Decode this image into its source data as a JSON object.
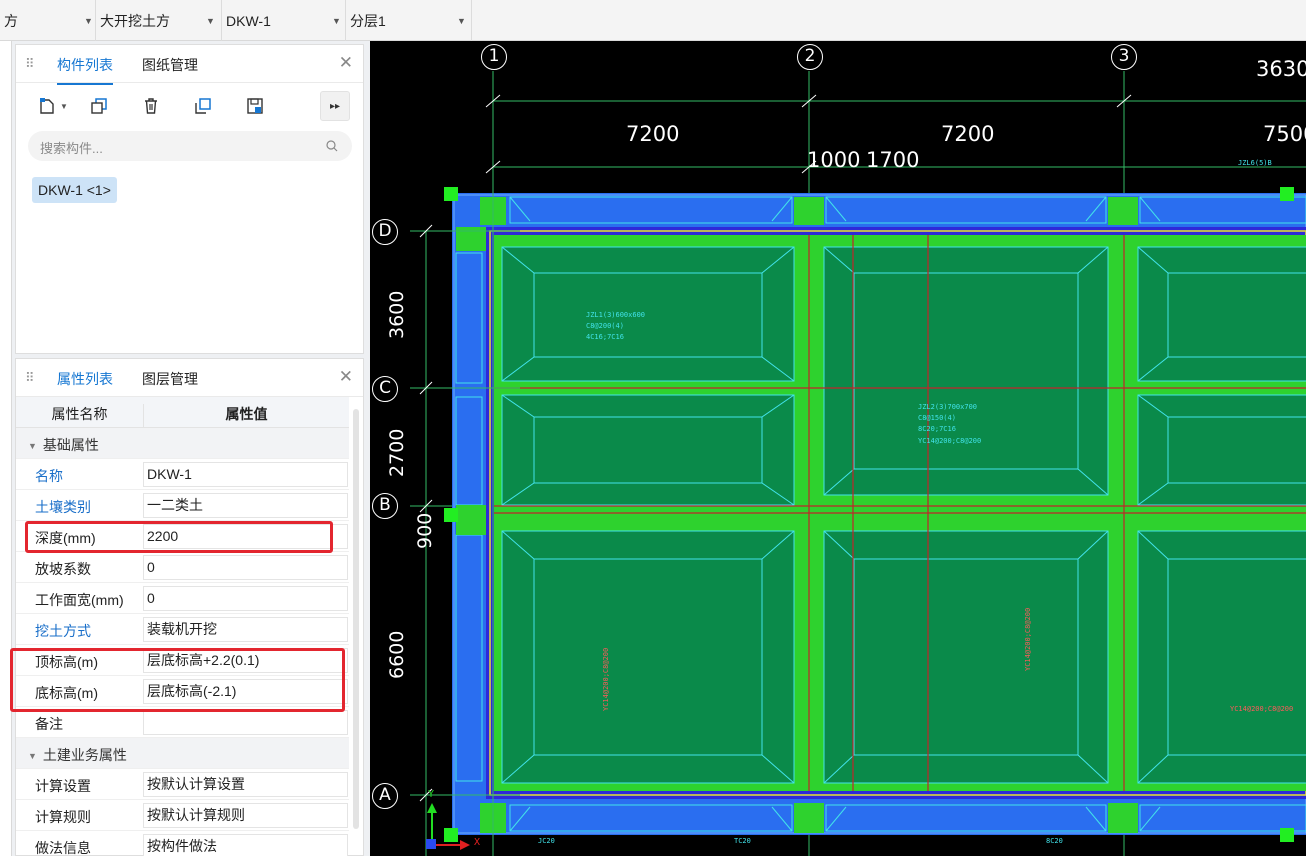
{
  "toolbar": {
    "sel0": "方",
    "sel1": "大开挖土方",
    "sel2": "DKW-1",
    "sel3": "分层1"
  },
  "component_panel": {
    "tab_active": "构件列表",
    "tab_other": "图纸管理",
    "search_placeholder": "搜索构件...",
    "item": "DKW-1  <1>",
    "icons": [
      "new-icon",
      "dropdown-icon",
      "copy-icon",
      "delete-icon",
      "layer-copy-icon",
      "save-icon",
      "expand-icon"
    ]
  },
  "property_panel": {
    "tab_active": "属性列表",
    "tab_other": "图层管理",
    "col_name": "属性名称",
    "col_value": "属性值",
    "group_basic": "基础属性",
    "group_civil": "土建业务属性",
    "rows": [
      {
        "name": "名称",
        "value": "DKW-1"
      },
      {
        "name": "土壤类别",
        "value": "一二类土"
      },
      {
        "name": "深度(mm)",
        "value": "2200"
      },
      {
        "name": "放坡系数",
        "value": "0"
      },
      {
        "name": "工作面宽(mm)",
        "value": "0"
      },
      {
        "name": "挖土方式",
        "value": "装载机开挖"
      },
      {
        "name": "顶标高(m)",
        "value": "层底标高+2.2(0.1)"
      },
      {
        "name": "底标高(m)",
        "value": "层底标高(-2.1)"
      },
      {
        "name": "备注",
        "value": ""
      }
    ],
    "civil_rows": [
      {
        "name": "计算设置",
        "value": "按默认计算设置"
      },
      {
        "name": "计算规则",
        "value": "按默认计算规则"
      },
      {
        "name": "做法信息",
        "value": "按构件做法"
      }
    ],
    "highlight_color": "#e3262f"
  },
  "drawing": {
    "col_axes": [
      "1",
      "2",
      "3"
    ],
    "row_axes": [
      "D",
      "C",
      "B",
      "A"
    ],
    "dims_top": [
      "3630",
      "7200",
      "7200",
      "7500",
      "1000",
      "1700"
    ],
    "dims_left": [
      "3600",
      "2700",
      "900",
      "6600"
    ],
    "ucs_x": "X",
    "ucs_y": "Y",
    "colors": {
      "background": "#000000",
      "pit": "#2ed22e",
      "raft": "#0a8a4a",
      "edge": "#2a6ef0",
      "grid": "#c0262a",
      "text": "#42e3ea"
    },
    "annotations": {
      "beam_main": "JZL1(3)600x600",
      "beam_a": "C8@200(4)",
      "beam_b": "4C16;7C16",
      "beam_c": "JZL2(3)700x700",
      "beam_d": "C8@150(4)",
      "beam_e": "8C20;7C16",
      "beam_f": "YC14@200;C8@200",
      "small_a": "JZL6(5)B",
      "small_b": "JC20",
      "small_c": "TC20",
      "small_d": "8C20"
    }
  }
}
